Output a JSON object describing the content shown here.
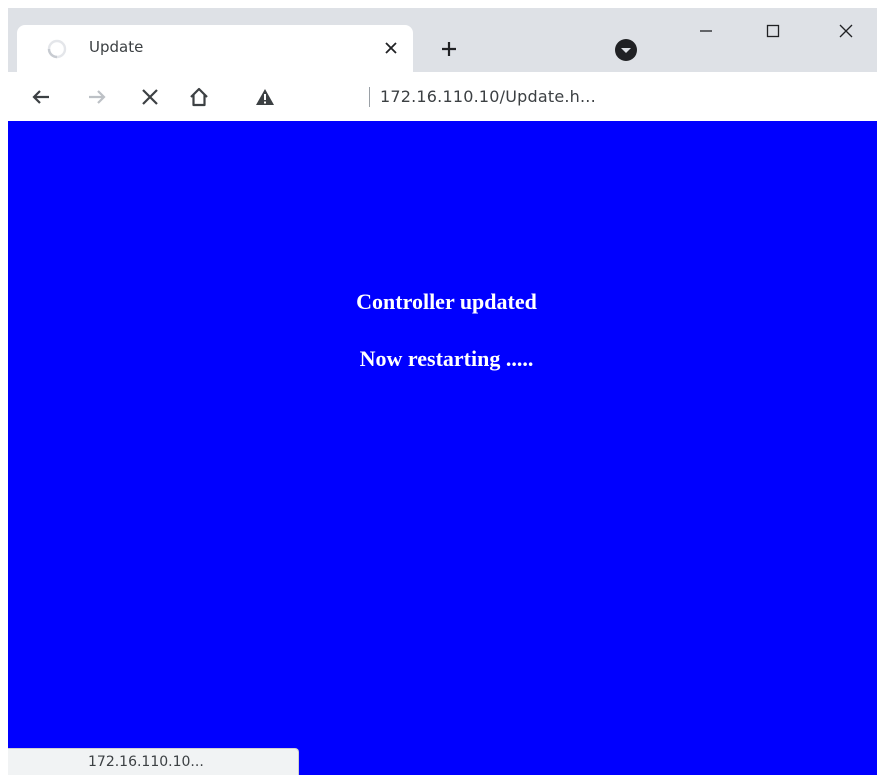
{
  "browser": {
    "tab": {
      "title": "Update",
      "close_icon": "close-icon"
    },
    "new_tab_icon": "plus-icon",
    "profile_icon": "profile-icon",
    "window_controls": [
      "minimize-icon",
      "maximize-icon",
      "close-icon"
    ]
  },
  "toolbar": {
    "back_icon": "arrow-left-icon",
    "forward_icon": "arrow-right-icon",
    "stop_icon": "stop-icon",
    "home_icon": "home-icon",
    "security_icon": "warning-icon",
    "url": "172.16.110.10/Update.h..."
  },
  "page": {
    "background": "#0000ff",
    "text_color": "#ffffff",
    "message_line1": "Controller updated",
    "message_line2": "Now restarting ....."
  },
  "status": {
    "text": "172.16.110.10..."
  }
}
